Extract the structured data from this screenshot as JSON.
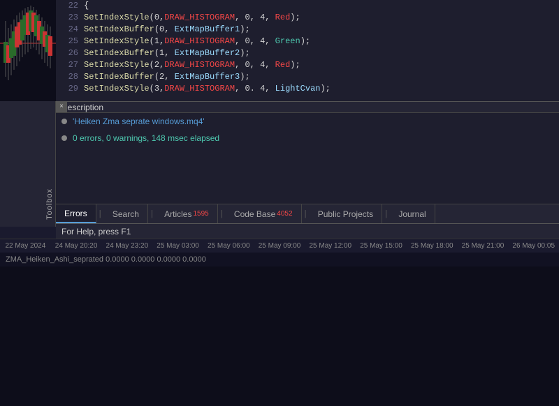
{
  "chart": {
    "bottom_strip": "ZMA_Heiken_Ashi_seprated 0.0000 0.0000 0.0000 0.0000"
  },
  "code": {
    "lines": [
      {
        "num": "22",
        "content": "{",
        "parts": [
          {
            "text": "{",
            "cls": ""
          }
        ]
      },
      {
        "num": "23",
        "content": "   SetIndexStyle(0,DRAW_HISTOGRAM, 0, 4, Red);",
        "parts": [
          {
            "text": "   ",
            "cls": ""
          },
          {
            "text": "SetIndexStyle",
            "cls": "kw-func"
          },
          {
            "text": "(0,",
            "cls": ""
          },
          {
            "text": "DRAW_HISTOGRAM",
            "cls": "kw-draw"
          },
          {
            "text": ", 0, 4, ",
            "cls": ""
          },
          {
            "text": "Red",
            "cls": "kw-red"
          },
          {
            "text": ");",
            "cls": ""
          }
        ]
      },
      {
        "num": "24",
        "content": "   SetIndexBuffer(0, ExtMapBuffer1);",
        "parts": [
          {
            "text": "   ",
            "cls": ""
          },
          {
            "text": "SetIndexBuffer",
            "cls": "kw-func"
          },
          {
            "text": "(0, ",
            "cls": ""
          },
          {
            "text": "ExtMapBuffer1",
            "cls": "kw-param"
          },
          {
            "text": ");",
            "cls": ""
          }
        ]
      },
      {
        "num": "25",
        "content": "   SetIndexStyle(1,DRAW_HISTOGRAM, 0, 4, Green);",
        "parts": [
          {
            "text": "   ",
            "cls": ""
          },
          {
            "text": "SetIndexStyle",
            "cls": "kw-func"
          },
          {
            "text": "(1,",
            "cls": ""
          },
          {
            "text": "DRAW_HISTOGRAM",
            "cls": "kw-draw"
          },
          {
            "text": ", 0, 4, ",
            "cls": ""
          },
          {
            "text": "Green",
            "cls": "kw-green"
          },
          {
            "text": ");",
            "cls": ""
          }
        ]
      },
      {
        "num": "26",
        "content": "   SetIndexBuffer(1, ExtMapBuffer2);",
        "parts": [
          {
            "text": "   ",
            "cls": ""
          },
          {
            "text": "SetIndexBuffer",
            "cls": "kw-func"
          },
          {
            "text": "(1, ",
            "cls": ""
          },
          {
            "text": "ExtMapBuffer2",
            "cls": "kw-param"
          },
          {
            "text": ");",
            "cls": ""
          }
        ]
      },
      {
        "num": "27",
        "content": "   SetIndexStyle(2,DRAW_HISTOGRAM, 0, 4, Red);",
        "parts": [
          {
            "text": "   ",
            "cls": ""
          },
          {
            "text": "SetIndexStyle",
            "cls": "kw-func"
          },
          {
            "text": "(2,",
            "cls": ""
          },
          {
            "text": "DRAW_HISTOGRAM",
            "cls": "kw-draw"
          },
          {
            "text": ", 0, 4, ",
            "cls": ""
          },
          {
            "text": "Red",
            "cls": "kw-red"
          },
          {
            "text": ");",
            "cls": ""
          }
        ]
      },
      {
        "num": "28",
        "content": "   SetIndexBuffer(2, ExtMapBuffer3);",
        "parts": [
          {
            "text": "   ",
            "cls": ""
          },
          {
            "text": "SetIndexBuffer",
            "cls": "kw-func"
          },
          {
            "text": "(2, ",
            "cls": ""
          },
          {
            "text": "ExtMapBuffer3",
            "cls": "kw-param"
          },
          {
            "text": ");",
            "cls": ""
          }
        ]
      },
      {
        "num": "29",
        "content": "   SetIndexStyle(3,DRAW_HISTOGRAM, 0, 4, LightCvan);",
        "parts": [
          {
            "text": "   ",
            "cls": ""
          },
          {
            "text": "SetIndexStyle",
            "cls": "kw-func"
          },
          {
            "text": "(3,",
            "cls": ""
          },
          {
            "text": "DRAW_HISTOGRAM",
            "cls": "kw-draw"
          },
          {
            "text": ", 0. 4, ",
            "cls": ""
          },
          {
            "text": "LightCvan",
            "cls": "kw-lightcyan"
          },
          {
            "text": ");",
            "cls": ""
          }
        ]
      }
    ]
  },
  "panel": {
    "description_label": "Description",
    "close_label": "×",
    "rows": [
      {
        "text": "'Heiken Zma seprate windows.mq4'",
        "cls": "desc-text-file"
      },
      {
        "text": "0 errors, 0 warnings, 148 msec elapsed",
        "cls": "desc-text-ok"
      }
    ],
    "toolbox_label": "Toolbox"
  },
  "tabs": [
    {
      "label": "Errors",
      "badge": "",
      "active": true
    },
    {
      "label": "Search",
      "badge": "",
      "active": false
    },
    {
      "label": "Articles",
      "badge": "1595",
      "active": false
    },
    {
      "label": "Code Base",
      "badge": "4052",
      "active": false
    },
    {
      "label": "Public Projects",
      "badge": "",
      "active": false
    },
    {
      "label": "Journal",
      "badge": "",
      "active": false
    }
  ],
  "status_bar": {
    "text": "For Help, press F1"
  },
  "time_axis": {
    "labels": [
      "22 May 2024",
      "24 May 20:20",
      "24 May 23:20",
      "25 May 03:00",
      "25 May 06:00",
      "25 May 09:00",
      "25 May 12:00",
      "25 May 15:00",
      "25 May 18:00",
      "25 May 21:00",
      "26 May 00:05"
    ]
  }
}
